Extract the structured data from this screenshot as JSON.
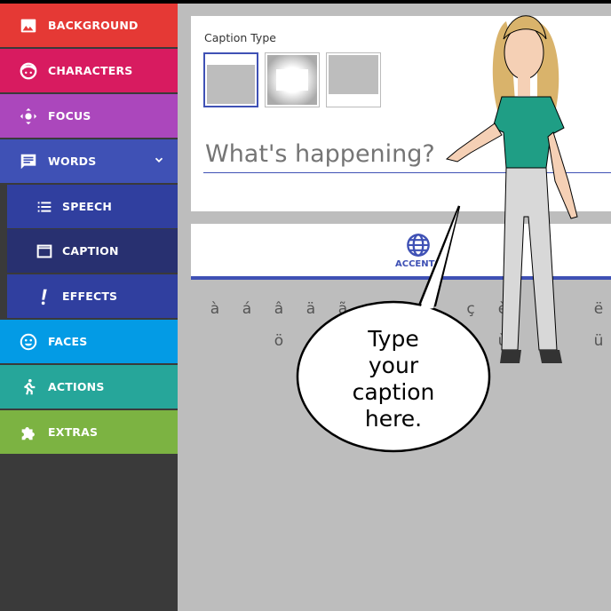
{
  "sidebar": {
    "items": [
      {
        "label": "BACKGROUND",
        "icon": "image-icon",
        "color": "#e53935"
      },
      {
        "label": "CHARACTERS",
        "icon": "character-face-icon",
        "color": "#d81b60"
      },
      {
        "label": "FOCUS",
        "icon": "focus-move-icon",
        "color": "#ab47bc"
      },
      {
        "label": "WORDS",
        "icon": "speech-bubble-icon",
        "color": "#3f51b5"
      },
      {
        "label": "SPEECH",
        "icon": "list-icon",
        "color": "#303f9f"
      },
      {
        "label": "CAPTION",
        "icon": "caption-window-icon",
        "color": "#283070"
      },
      {
        "label": "EFFECTS",
        "icon": "exclamation-icon",
        "color": "#303f9f"
      },
      {
        "label": "FACES",
        "icon": "smiley-icon",
        "color": "#039be5"
      },
      {
        "label": "ACTIONS",
        "icon": "running-icon",
        "color": "#26a69a"
      },
      {
        "label": "EXTRAS",
        "icon": "puzzle-icon",
        "color": "#7cb342"
      }
    ]
  },
  "caption": {
    "type_label": "Caption Type",
    "placeholder": "What's happening?",
    "selected_type": 0
  },
  "tabs": {
    "accents_label": "ACCENTS",
    "accents_icon": "globe-icon"
  },
  "accents": {
    "row1": [
      "à",
      "á",
      "â",
      "ä",
      "ã",
      "",
      "",
      "",
      "ç",
      "è",
      "",
      "",
      "ë"
    ],
    "row2": [
      "",
      "",
      "ö",
      "",
      "",
      "",
      "",
      "",
      "",
      "ù",
      "",
      "",
      "ü"
    ]
  },
  "bubble": {
    "lines": [
      "Type",
      "your",
      "caption",
      "here."
    ]
  },
  "accent_color": "#3f51b5"
}
